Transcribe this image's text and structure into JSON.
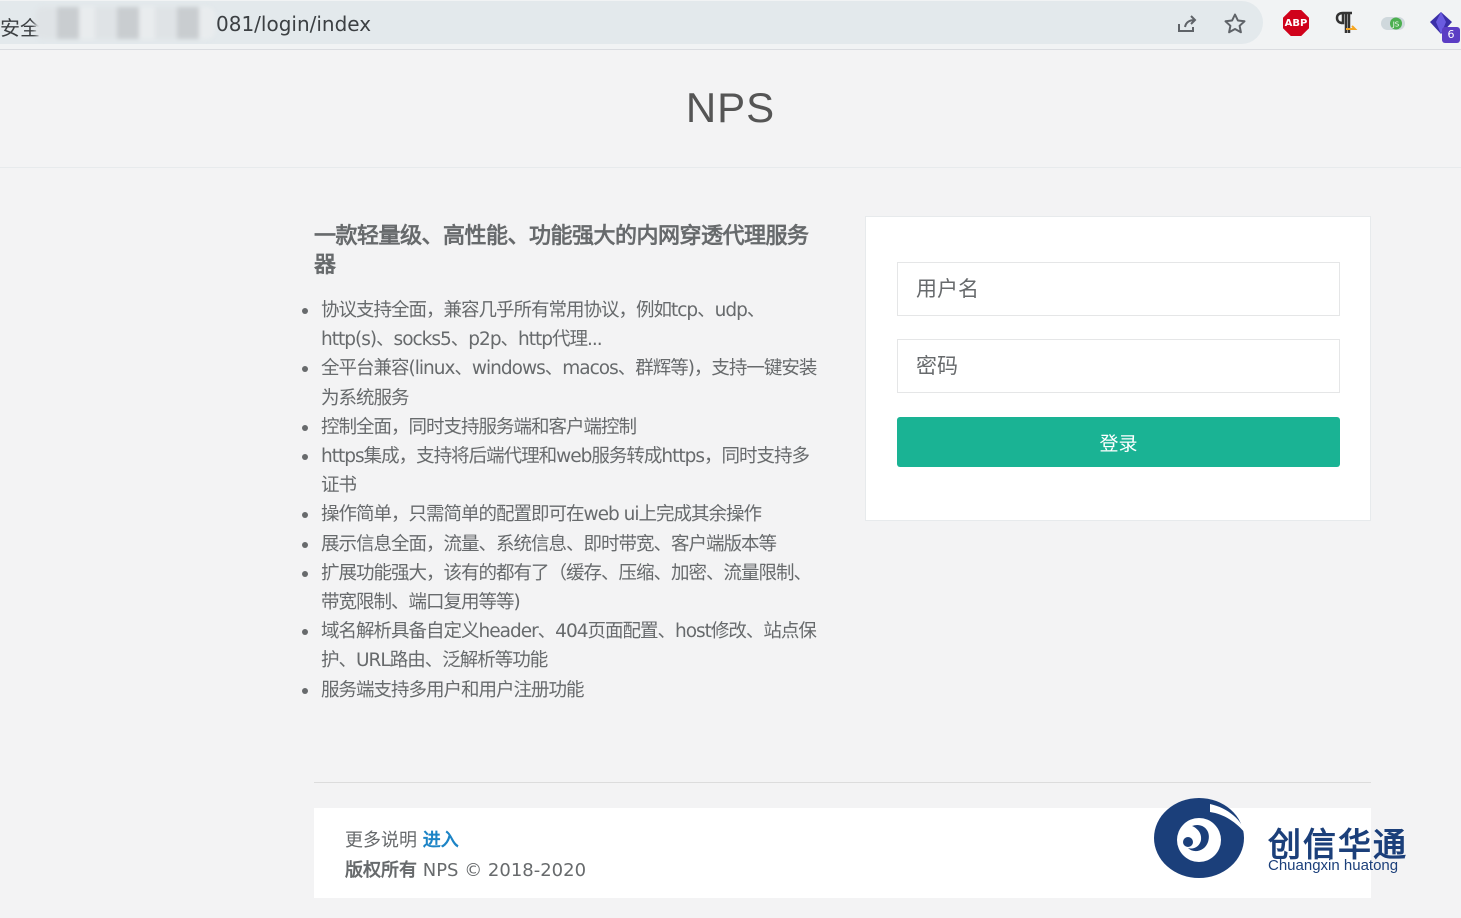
{
  "browser": {
    "security_text": "不安全",
    "url_text": "081/login/index",
    "abp_label": "ABP",
    "extension_badge": "6"
  },
  "header": {
    "title": "NPS"
  },
  "intro": {
    "title": "一款轻量级、高性能、功能强大的内网穿透代理服务器",
    "features": [
      "协议支持全面，兼容几乎所有常用协议，例如tcp、udp、http(s)、socks5、p2p、http代理...",
      "全平台兼容(linux、windows、macos、群辉等)，支持一键安装为系统服务",
      "控制全面，同时支持服务端和客户端控制",
      "https集成，支持将后端代理和web服务转成https，同时支持多证书",
      "操作简单，只需简单的配置即可在web ui上完成其余操作",
      "展示信息全面，流量、系统信息、即时带宽、客户端版本等",
      "扩展功能强大，该有的都有了（缓存、压缩、加密、流量限制、带宽限制、端口复用等等)",
      "域名解析具备自定义header、404页面配置、host修改、站点保护、URL路由、泛解析等功能",
      "服务端支持多用户和用户注册功能"
    ]
  },
  "login": {
    "username_placeholder": "用户名",
    "username_value": "",
    "password_placeholder": "密码",
    "password_value": "",
    "submit_label": "登录"
  },
  "footer": {
    "more_label": "更多说明",
    "more_link": "进入",
    "copyright_label": "版权所有",
    "copyright_text": "NPS © 2018-2020"
  },
  "watermark": {
    "name_cn": "创信华通",
    "name_en": "Chuangxin huatong"
  },
  "colors": {
    "accent": "#1ab394",
    "link": "#1c84c6",
    "text": "#676a6c",
    "background": "#f3f3f4",
    "logo_blue": "#1b3f7a"
  }
}
